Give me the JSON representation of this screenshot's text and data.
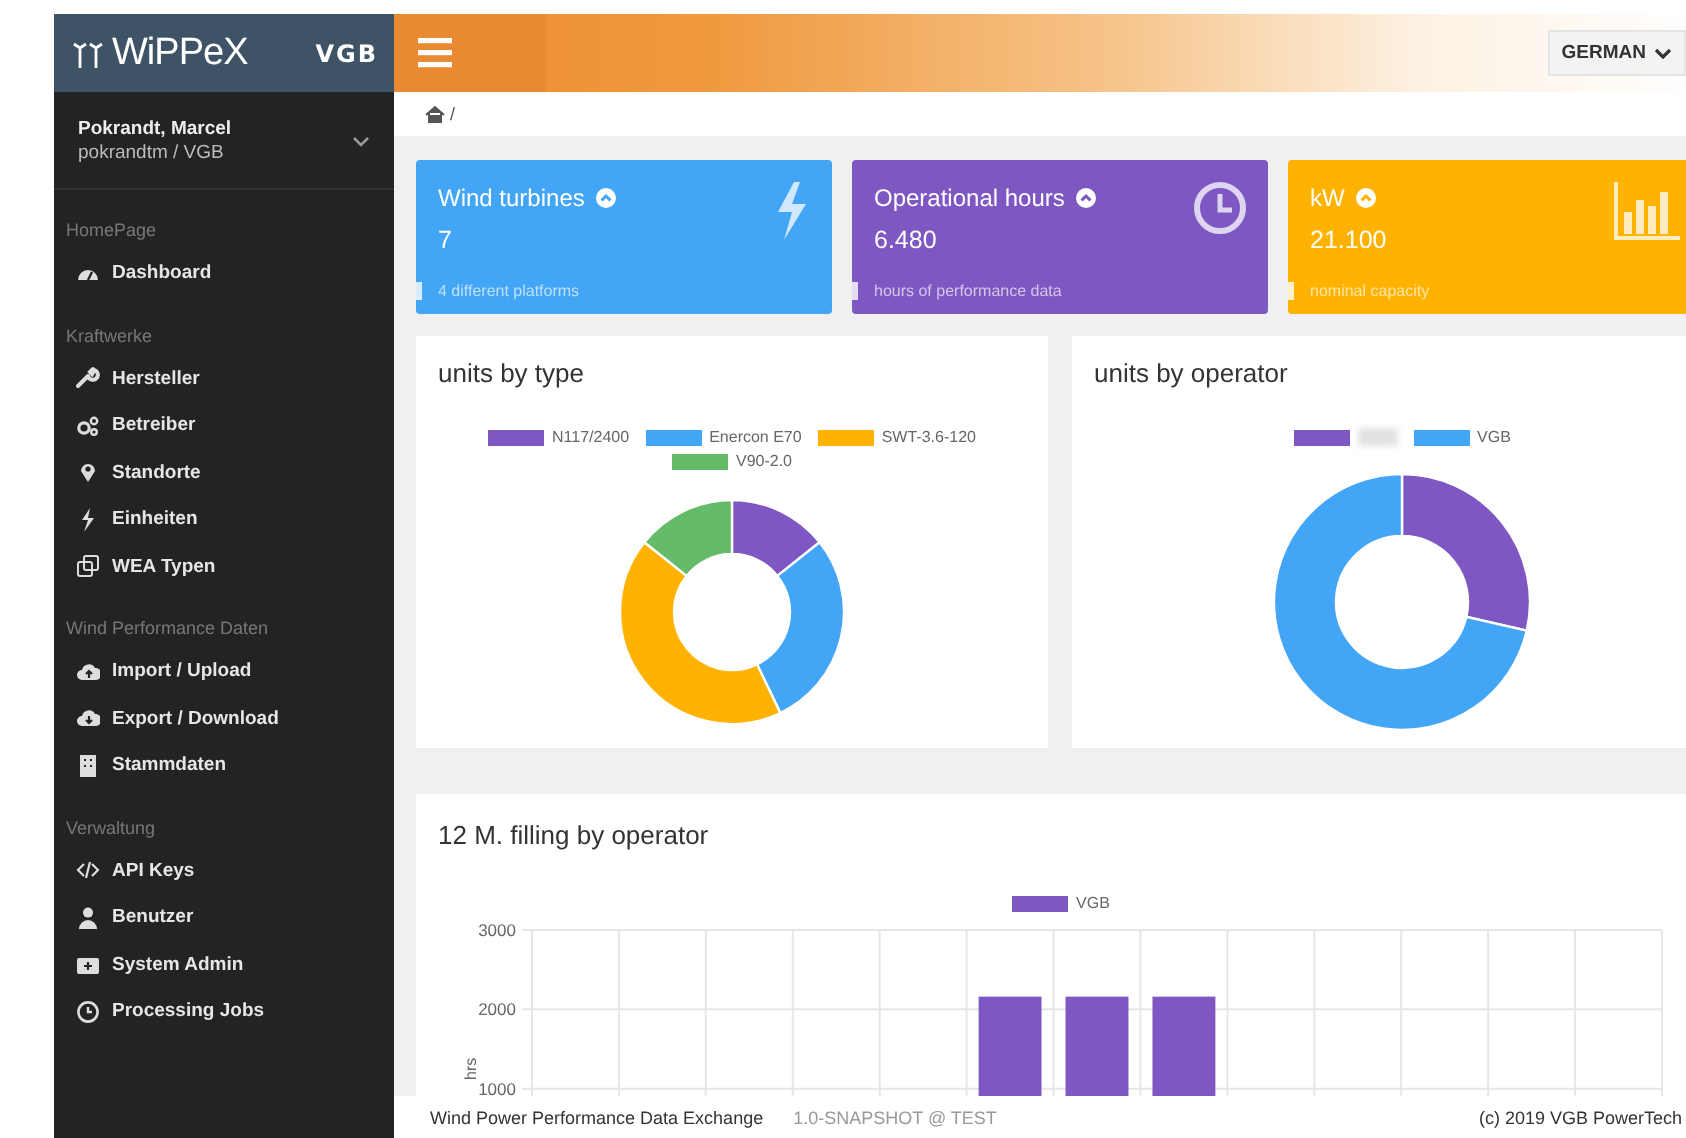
{
  "sidebar": {
    "brand": "WiPPeX",
    "org_logo": "VGB",
    "user": {
      "name": "Pokrandt, Marcel",
      "login": "pokrandtm / VGB"
    },
    "sections": [
      {
        "heading": "HomePage",
        "items": [
          {
            "label": "Dashboard"
          }
        ]
      },
      {
        "heading": "Kraftwerke",
        "items": [
          {
            "label": "Hersteller"
          },
          {
            "label": "Betreiber"
          },
          {
            "label": "Standorte"
          },
          {
            "label": "Einheiten"
          },
          {
            "label": "WEA Typen"
          }
        ]
      },
      {
        "heading": "Wind Performance Daten",
        "items": [
          {
            "label": "Import / Upload"
          },
          {
            "label": "Export / Download"
          },
          {
            "label": "Stammdaten"
          }
        ]
      },
      {
        "heading": "Verwaltung",
        "items": [
          {
            "label": "API Keys"
          },
          {
            "label": "Benutzer"
          },
          {
            "label": "System Admin"
          },
          {
            "label": "Processing Jobs"
          }
        ]
      }
    ]
  },
  "header": {
    "language": "GERMAN"
  },
  "breadcrumb": {
    "separator": "/"
  },
  "stats": [
    {
      "title": "Wind turbines",
      "value": "7",
      "caption": "4 different platforms",
      "color": "#42a5f5"
    },
    {
      "title": "Operational hours",
      "value": "6.480",
      "caption": "hours of performance data",
      "color": "#7e57c2"
    },
    {
      "title": "kW",
      "value": "21.100",
      "caption": "nominal capacity",
      "color": "#ffb300"
    }
  ],
  "charts": [
    {
      "title": "units by type",
      "chart_data": {
        "type": "donut",
        "legend": "top",
        "categories": [
          "N117/2400",
          "Enercon E70",
          "SWT-3.6-120",
          "V90-2.0"
        ],
        "colors": [
          "#7e57c2",
          "#42a5f5",
          "#ffb300",
          "#66bb6a"
        ],
        "values": [
          14.3,
          28.6,
          42.8,
          14.3
        ]
      }
    },
    {
      "title": "units by operator",
      "chart_data": {
        "type": "donut",
        "legend": "top",
        "categories": [
          null,
          "VGB"
        ],
        "colors": [
          "#7e57c2",
          "#42a5f5"
        ],
        "values": [
          28.6,
          71.4
        ]
      }
    }
  ],
  "bar_chart": {
    "title": "12 M. filling by operator",
    "chart_data": {
      "type": "bar",
      "legend": "top",
      "ylabel": "hrs",
      "ylim": [
        0,
        3000
      ],
      "yticks": [
        1000,
        2000,
        3000
      ],
      "series": [
        {
          "name": "VGB",
          "color": "#7e57c2",
          "values": [
            null,
            null,
            null,
            null,
            null,
            2160,
            2160,
            2160,
            null,
            null,
            null,
            null,
            null
          ]
        }
      ]
    }
  },
  "footer": {
    "app_name": "Wind Power Performance Data Exchange",
    "version": "1.0-SNAPSHOT @ TEST",
    "copyright": "(c) 2019 VGB PowerTech"
  }
}
